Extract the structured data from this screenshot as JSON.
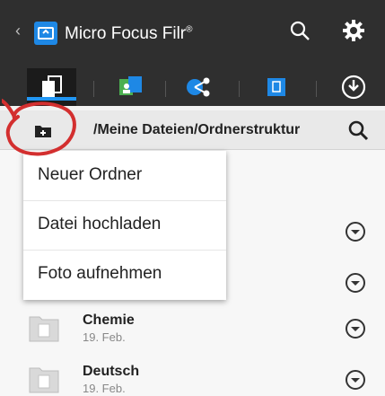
{
  "app": {
    "title": "Micro Focus Filr",
    "title_sup": "®"
  },
  "path": {
    "text": "/Meine Dateien/Ordnerstruktur"
  },
  "menu": {
    "items": [
      {
        "label": "Neuer Ordner"
      },
      {
        "label": "Datei hochladen"
      },
      {
        "label": "Foto aufnehmen"
      }
    ]
  },
  "folders": [
    {
      "name": "Chemie",
      "date": "19. Feb."
    },
    {
      "name": "Deutsch",
      "date": "19. Feb."
    }
  ],
  "colors": {
    "topbar": "#2f2f2f",
    "accent": "#2196f3",
    "annotation": "#d32f2f"
  }
}
